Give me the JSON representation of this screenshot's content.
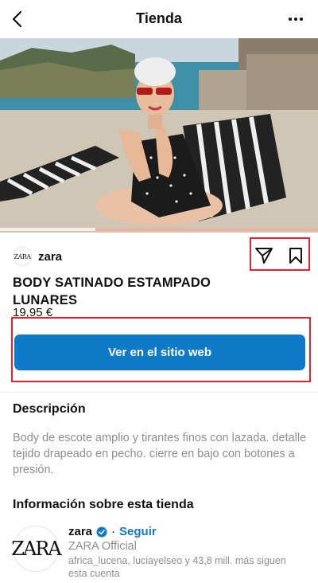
{
  "header": {
    "title": "Tienda",
    "back_icon": "chevron-left-icon",
    "more_icon": "more-horizontal-icon"
  },
  "gallery": {
    "progress_fraction": 0.3
  },
  "brand": {
    "logo_text": "ZARA",
    "name": "zara",
    "share_icon": "paper-plane-icon",
    "save_icon": "bookmark-icon"
  },
  "product": {
    "name": "BODY SATINADO ESTAMPADO LUNARES",
    "price": "19,95 €",
    "cta_label": "Ver en el sitio web"
  },
  "description": {
    "title": "Descripción",
    "text": "Body de escote amplio y tirantes finos con lazada. detalle tejido drapeado en pecho. cierre en bajo con botones a presión."
  },
  "store": {
    "section_title": "Información sobre esta tienda",
    "avatar_text": "ZARA",
    "username": "zara",
    "separator": "·",
    "follow_label": "Seguir",
    "full_name": "ZARA Official",
    "followers_text": "africa_lucena, luciayelseo y 43,8 mill. más siguen esta cuenta"
  },
  "colors": {
    "accent_blue": "#0f7ac8",
    "highlight_red": "#e0232e",
    "muted_text": "#8e8e8e"
  }
}
